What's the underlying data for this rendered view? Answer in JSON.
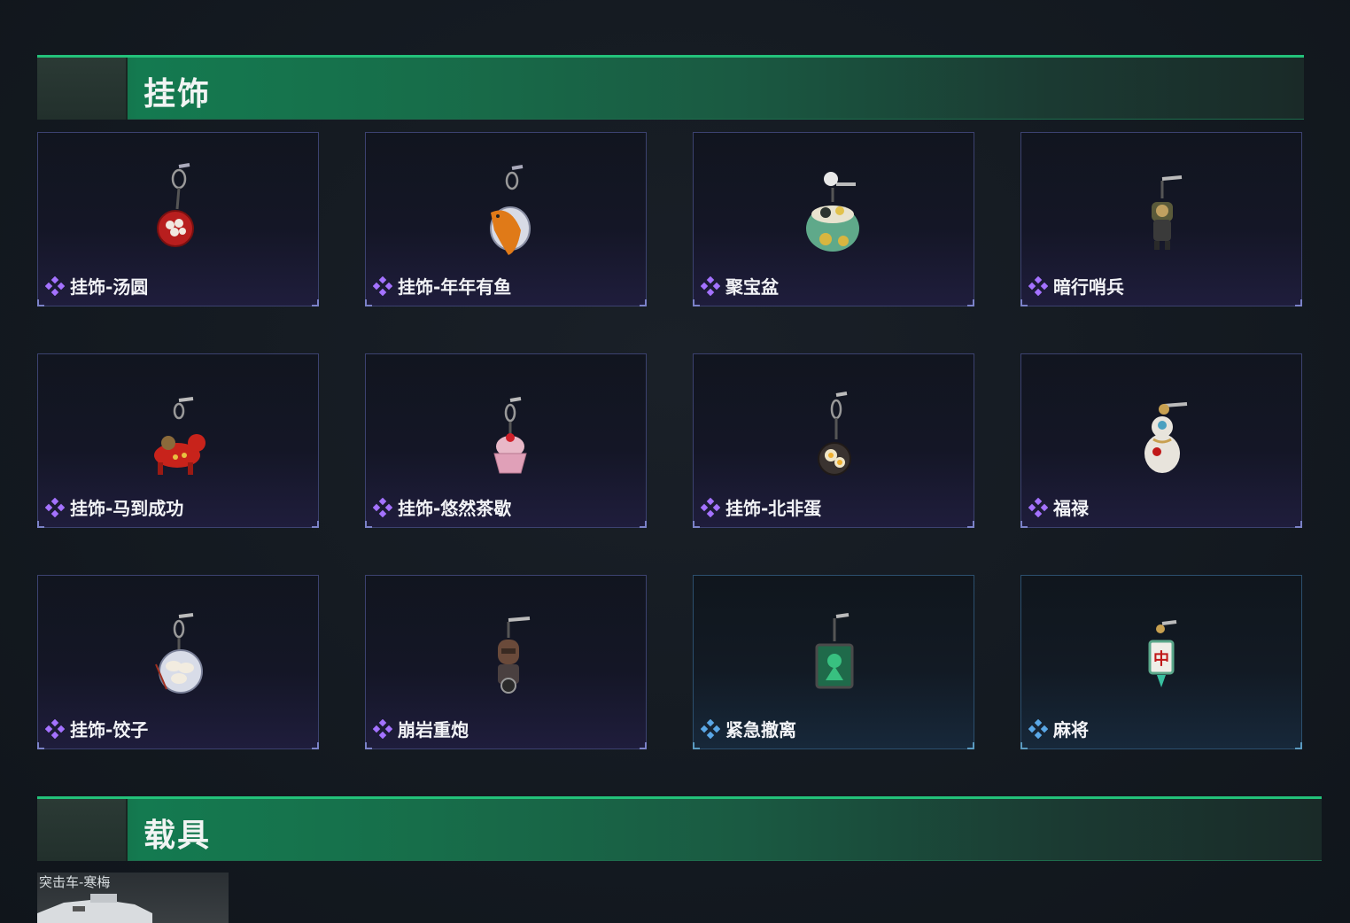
{
  "sections": {
    "charms": {
      "title": "挂饰"
    },
    "vehicles": {
      "title": "载具"
    }
  },
  "gem_colors": {
    "purple": "#a472ff",
    "blue": "#5aa7e6"
  },
  "items": [
    {
      "name": "挂饰-汤圆",
      "icon": "tangyuan-bowl-icon",
      "rarity": "purple"
    },
    {
      "name": "挂饰-年年有鱼",
      "icon": "fish-plate-icon",
      "rarity": "purple"
    },
    {
      "name": "聚宝盆",
      "icon": "treasure-bowl-icon",
      "rarity": "purple"
    },
    {
      "name": "暗行哨兵",
      "icon": "sentinel-figure-icon",
      "rarity": "purple"
    },
    {
      "name": "挂饰-马到成功",
      "icon": "red-horse-icon",
      "rarity": "purple"
    },
    {
      "name": "挂饰-悠然茶歇",
      "icon": "cupcake-icon",
      "rarity": "purple"
    },
    {
      "name": "挂饰-北非蛋",
      "icon": "egg-pan-icon",
      "rarity": "purple"
    },
    {
      "name": "福禄",
      "icon": "gourd-icon",
      "rarity": "purple"
    },
    {
      "name": "挂饰-饺子",
      "icon": "dumpling-plate-icon",
      "rarity": "purple"
    },
    {
      "name": "崩岩重炮",
      "icon": "cannon-figure-icon",
      "rarity": "purple"
    },
    {
      "name": "紧急撤离",
      "icon": "green-tag-icon",
      "rarity": "blue"
    },
    {
      "name": "麻将",
      "icon": "mahjong-tile-icon",
      "rarity": "blue"
    }
  ],
  "vehicle": {
    "name": "突击车-寒梅",
    "icon": "assault-vehicle-icon"
  }
}
